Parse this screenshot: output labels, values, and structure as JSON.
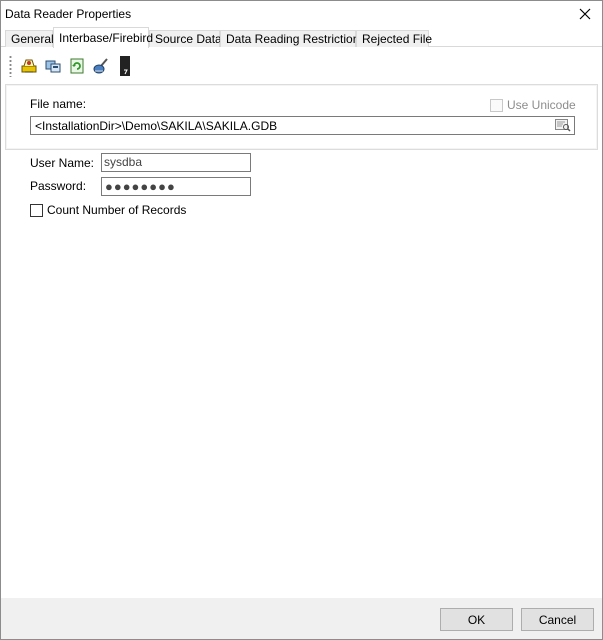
{
  "window": {
    "title": "Data Reader Properties"
  },
  "tabs": [
    {
      "label": "General"
    },
    {
      "label": "Interbase/Firebird"
    },
    {
      "label": "Source Data"
    },
    {
      "label": "Data Reading Restrictions"
    },
    {
      "label": "Rejected File"
    }
  ],
  "active_tab": "Interbase/Firebird",
  "toolbar": {
    "icons": [
      "connect-icon",
      "database-icon",
      "refresh-icon",
      "brush-icon",
      "file-icon"
    ]
  },
  "file": {
    "label": "File name:",
    "value": "<InstallationDir>\\Demo\\SAKILA\\SAKILA.GDB",
    "use_unicode_label": "Use Unicode",
    "use_unicode_checked": false
  },
  "credentials": {
    "user_label": "User Name:",
    "user_value": "sysdba",
    "password_label": "Password:",
    "password_value": "●●●●●●●●"
  },
  "count_records": {
    "label": "Count Number of Records",
    "checked": false
  },
  "buttons": {
    "ok": "OK",
    "cancel": "Cancel"
  },
  "colors": {
    "window_bg": "#f0f0f0",
    "content_bg": "#ffffff",
    "button_bg": "#e1e1e1"
  }
}
